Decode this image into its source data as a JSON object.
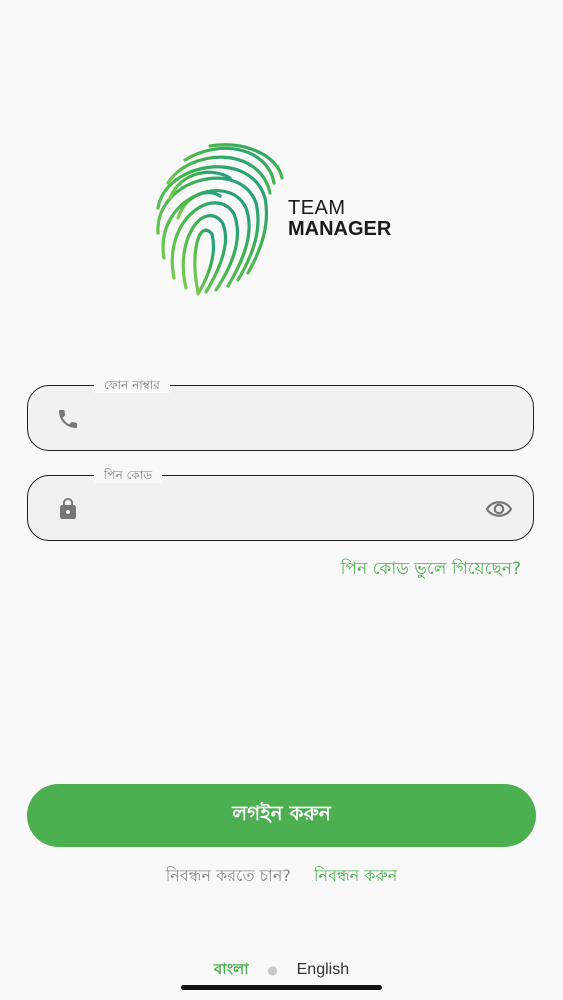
{
  "logo": {
    "line1": "TEAM",
    "line2": "MANAGER",
    "icon": "fingerprint-icon"
  },
  "form": {
    "phone_label": "ফোন নাম্বার",
    "phone_value": "",
    "pin_label": "পিন কোড",
    "pin_value": "",
    "forgot_label": "পিন কোড ভুলে গিয়েছেন?"
  },
  "login_button_label": "লগইন করুন",
  "register": {
    "question": "নিবন্ধন করতে চান?",
    "link": "নিবন্ধন করুন"
  },
  "language": {
    "bangla": "বাংলা",
    "english": "English",
    "selected": "বাংলা"
  },
  "colors": {
    "accent": "#4CAF50",
    "background": "#F9F9F9"
  }
}
